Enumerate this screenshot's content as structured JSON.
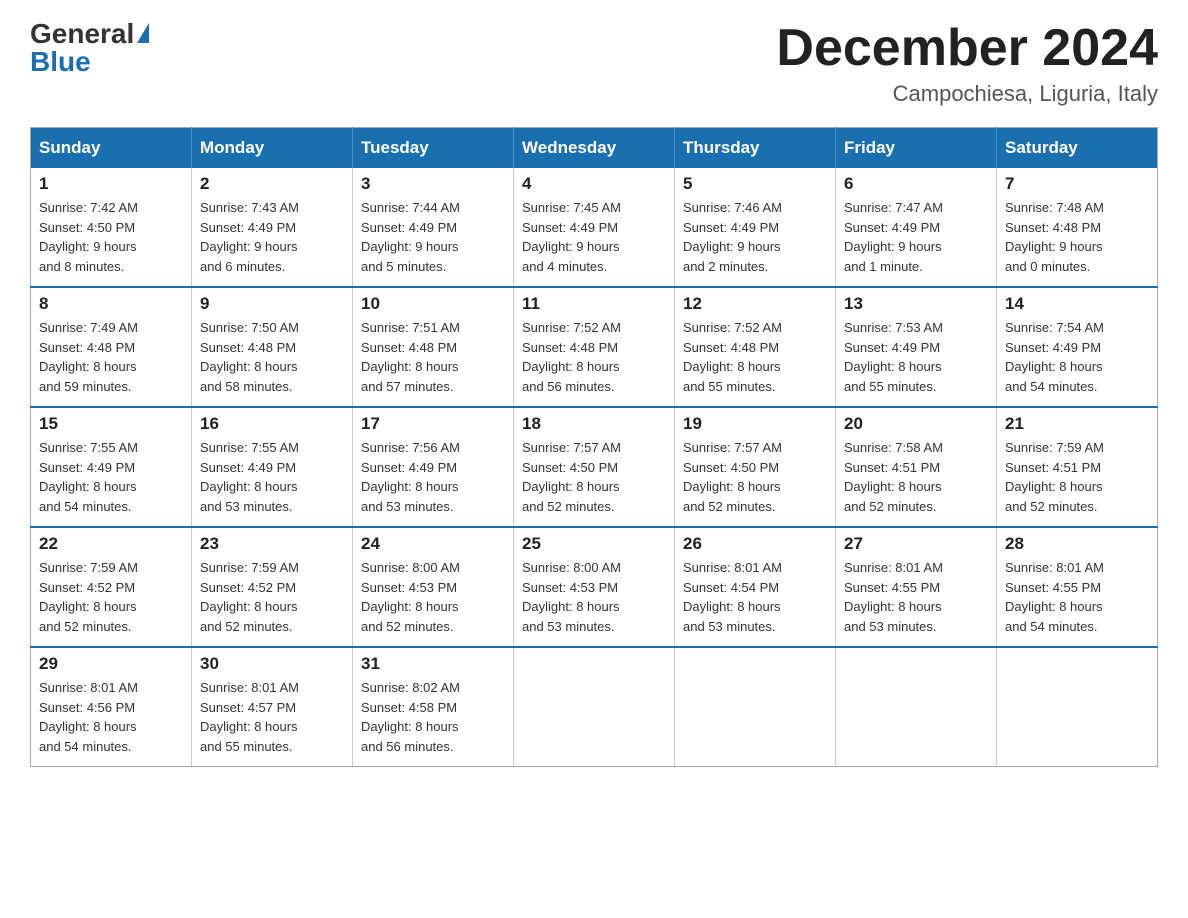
{
  "logo": {
    "general": "General",
    "triangle": "▶",
    "blue": "Blue"
  },
  "header": {
    "month": "December 2024",
    "location": "Campochiesa, Liguria, Italy"
  },
  "days_of_week": [
    "Sunday",
    "Monday",
    "Tuesday",
    "Wednesday",
    "Thursday",
    "Friday",
    "Saturday"
  ],
  "weeks": [
    [
      {
        "day": "1",
        "info": "Sunrise: 7:42 AM\nSunset: 4:50 PM\nDaylight: 9 hours\nand 8 minutes."
      },
      {
        "day": "2",
        "info": "Sunrise: 7:43 AM\nSunset: 4:49 PM\nDaylight: 9 hours\nand 6 minutes."
      },
      {
        "day": "3",
        "info": "Sunrise: 7:44 AM\nSunset: 4:49 PM\nDaylight: 9 hours\nand 5 minutes."
      },
      {
        "day": "4",
        "info": "Sunrise: 7:45 AM\nSunset: 4:49 PM\nDaylight: 9 hours\nand 4 minutes."
      },
      {
        "day": "5",
        "info": "Sunrise: 7:46 AM\nSunset: 4:49 PM\nDaylight: 9 hours\nand 2 minutes."
      },
      {
        "day": "6",
        "info": "Sunrise: 7:47 AM\nSunset: 4:49 PM\nDaylight: 9 hours\nand 1 minute."
      },
      {
        "day": "7",
        "info": "Sunrise: 7:48 AM\nSunset: 4:48 PM\nDaylight: 9 hours\nand 0 minutes."
      }
    ],
    [
      {
        "day": "8",
        "info": "Sunrise: 7:49 AM\nSunset: 4:48 PM\nDaylight: 8 hours\nand 59 minutes."
      },
      {
        "day": "9",
        "info": "Sunrise: 7:50 AM\nSunset: 4:48 PM\nDaylight: 8 hours\nand 58 minutes."
      },
      {
        "day": "10",
        "info": "Sunrise: 7:51 AM\nSunset: 4:48 PM\nDaylight: 8 hours\nand 57 minutes."
      },
      {
        "day": "11",
        "info": "Sunrise: 7:52 AM\nSunset: 4:48 PM\nDaylight: 8 hours\nand 56 minutes."
      },
      {
        "day": "12",
        "info": "Sunrise: 7:52 AM\nSunset: 4:48 PM\nDaylight: 8 hours\nand 55 minutes."
      },
      {
        "day": "13",
        "info": "Sunrise: 7:53 AM\nSunset: 4:49 PM\nDaylight: 8 hours\nand 55 minutes."
      },
      {
        "day": "14",
        "info": "Sunrise: 7:54 AM\nSunset: 4:49 PM\nDaylight: 8 hours\nand 54 minutes."
      }
    ],
    [
      {
        "day": "15",
        "info": "Sunrise: 7:55 AM\nSunset: 4:49 PM\nDaylight: 8 hours\nand 54 minutes."
      },
      {
        "day": "16",
        "info": "Sunrise: 7:55 AM\nSunset: 4:49 PM\nDaylight: 8 hours\nand 53 minutes."
      },
      {
        "day": "17",
        "info": "Sunrise: 7:56 AM\nSunset: 4:49 PM\nDaylight: 8 hours\nand 53 minutes."
      },
      {
        "day": "18",
        "info": "Sunrise: 7:57 AM\nSunset: 4:50 PM\nDaylight: 8 hours\nand 52 minutes."
      },
      {
        "day": "19",
        "info": "Sunrise: 7:57 AM\nSunset: 4:50 PM\nDaylight: 8 hours\nand 52 minutes."
      },
      {
        "day": "20",
        "info": "Sunrise: 7:58 AM\nSunset: 4:51 PM\nDaylight: 8 hours\nand 52 minutes."
      },
      {
        "day": "21",
        "info": "Sunrise: 7:59 AM\nSunset: 4:51 PM\nDaylight: 8 hours\nand 52 minutes."
      }
    ],
    [
      {
        "day": "22",
        "info": "Sunrise: 7:59 AM\nSunset: 4:52 PM\nDaylight: 8 hours\nand 52 minutes."
      },
      {
        "day": "23",
        "info": "Sunrise: 7:59 AM\nSunset: 4:52 PM\nDaylight: 8 hours\nand 52 minutes."
      },
      {
        "day": "24",
        "info": "Sunrise: 8:00 AM\nSunset: 4:53 PM\nDaylight: 8 hours\nand 52 minutes."
      },
      {
        "day": "25",
        "info": "Sunrise: 8:00 AM\nSunset: 4:53 PM\nDaylight: 8 hours\nand 53 minutes."
      },
      {
        "day": "26",
        "info": "Sunrise: 8:01 AM\nSunset: 4:54 PM\nDaylight: 8 hours\nand 53 minutes."
      },
      {
        "day": "27",
        "info": "Sunrise: 8:01 AM\nSunset: 4:55 PM\nDaylight: 8 hours\nand 53 minutes."
      },
      {
        "day": "28",
        "info": "Sunrise: 8:01 AM\nSunset: 4:55 PM\nDaylight: 8 hours\nand 54 minutes."
      }
    ],
    [
      {
        "day": "29",
        "info": "Sunrise: 8:01 AM\nSunset: 4:56 PM\nDaylight: 8 hours\nand 54 minutes."
      },
      {
        "day": "30",
        "info": "Sunrise: 8:01 AM\nSunset: 4:57 PM\nDaylight: 8 hours\nand 55 minutes."
      },
      {
        "day": "31",
        "info": "Sunrise: 8:02 AM\nSunset: 4:58 PM\nDaylight: 8 hours\nand 56 minutes."
      },
      {
        "day": "",
        "info": ""
      },
      {
        "day": "",
        "info": ""
      },
      {
        "day": "",
        "info": ""
      },
      {
        "day": "",
        "info": ""
      }
    ]
  ]
}
